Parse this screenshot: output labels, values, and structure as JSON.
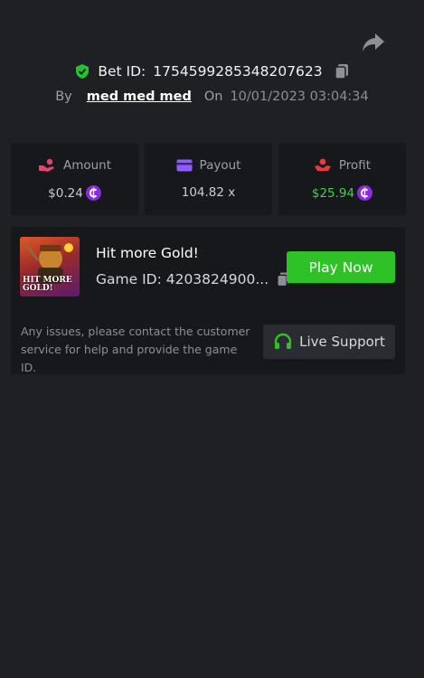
{
  "bet": {
    "label": "Bet ID:",
    "id": "1754599285348207623",
    "by_label": "By",
    "user": "med med med",
    "on_label": "On",
    "datetime": "10/01/2023 03:04:34"
  },
  "stats": {
    "amount": {
      "label": "Amount",
      "value": "$0.24",
      "icon": "hand-coins-icon"
    },
    "payout": {
      "label": "Payout",
      "value": "104.82 x",
      "icon": "card-icon"
    },
    "profit": {
      "label": "Profit",
      "value": "$25.94",
      "icon": "hand-coin-icon"
    }
  },
  "game": {
    "title": "Hit more Gold!",
    "id_text": "Game ID: 4203824900...",
    "thumbnail_text": "HIT MORE GOLD!",
    "play_label": "Play Now"
  },
  "support": {
    "message": "Any issues, please contact the customer service for help and provide the game ID.",
    "button_label": "Live Support"
  },
  "colors": {
    "background": "#1f2023",
    "card": "#17181b",
    "accent_green": "#2ec226",
    "profit_green": "#3dd24a",
    "coin_purple": "#8a2be2",
    "amount_icon": "#e8446a",
    "payout_icon": "#8f5cff",
    "profit_icon": "#e83a3a"
  }
}
